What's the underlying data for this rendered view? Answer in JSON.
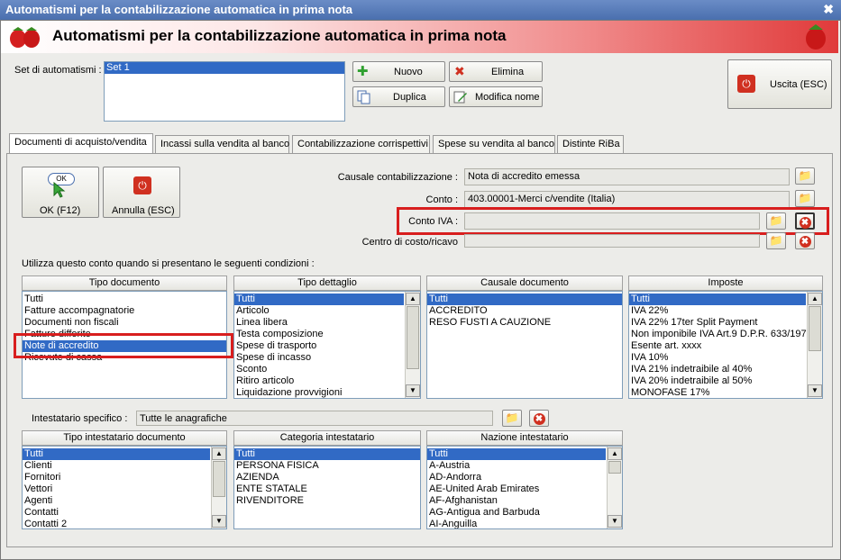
{
  "window": {
    "title": "Automatismi per la contabilizzazione automatica in prima nota",
    "close_glyph": "×"
  },
  "banner": {
    "title": "Automatismi per la contabilizzazione automatica in prima nota"
  },
  "set": {
    "label": "Set di automatismi :",
    "items": [
      "Set 1"
    ]
  },
  "toolbar": {
    "nuovo": "Nuovo",
    "elimina": "Elimina",
    "duplica": "Duplica",
    "modifica": "Modifica nome",
    "uscita": "Uscita (ESC)"
  },
  "tabs": [
    "Documenti di acquisto/vendita",
    "Incassi sulla vendita al banco",
    "Contabilizzazione corrispettivi",
    "Spese su vendita al banco",
    "Distinte RiBa"
  ],
  "actions": {
    "ok": "OK (F12)",
    "ok_icon_text": "OK",
    "annulla": "Annulla (ESC)"
  },
  "form": {
    "causale_label": "Causale contabilizzazione :",
    "causale_value": "Nota di accredito emessa",
    "conto_label": "Conto :",
    "conto_value": "403.00001-Merci c/vendite (Italia)",
    "conto_iva_label": "Conto IVA :",
    "conto_iva_value": "",
    "centro_label": "Centro di costo/ricavo",
    "centro_value": ""
  },
  "conditions_label": "Utilizza questo conto quando si presentano le seguenti condizioni :",
  "lists": {
    "tipo_documento": {
      "header": "Tipo documento",
      "items": [
        "Tutti",
        "Fatture accompagnatorie",
        "Documenti non fiscali",
        "Fatture differite",
        "Note di accredito",
        "Ricevute di cassa"
      ]
    },
    "tipo_dettaglio": {
      "header": "Tipo dettaglio",
      "items": [
        "Tutti",
        "Articolo",
        "Linea libera",
        "Testa composizione",
        "Spese di trasporto",
        "Spese di incasso",
        "Sconto",
        "Ritiro articolo",
        "Liquidazione provvigioni"
      ]
    },
    "causale_documento": {
      "header": "Causale documento",
      "items": [
        "Tutti",
        "ACCREDITO",
        "RESO FUSTI A CAUZIONE"
      ]
    },
    "imposte": {
      "header": "Imposte",
      "items": [
        "Tutti",
        "IVA 22%",
        "IVA 22% 17ter Split Payment",
        "Non imponibile IVA Art.9 D.P.R. 633/197",
        "Esente art. xxxx",
        "IVA 10%",
        "IVA 21% indetraibile al 40%",
        "IVA 20% indetraibile al 50%",
        "MONOFASE 17%"
      ]
    },
    "tipo_intestatario": {
      "header": "Tipo intestatario documento",
      "items": [
        "Tutti",
        "Clienti",
        "Fornitori",
        "Vettori",
        "Agenti",
        "Contatti",
        "Contatti 2"
      ]
    },
    "categoria": {
      "header": "Categoria intestatario",
      "items": [
        "Tutti",
        "PERSONA FISICA",
        "AZIENDA",
        "ENTE STATALE",
        "RIVENDITORE"
      ]
    },
    "nazione": {
      "header": "Nazione intestatario",
      "items": [
        "Tutti",
        "A-Austria",
        "AD-Andorra",
        "AE-United Arab Emirates",
        "AF-Afghanistan",
        "AG-Antigua and Barbuda",
        "AI-Anguilla"
      ]
    }
  },
  "intestatario": {
    "label": "Intestatario specifico :",
    "value": "Tutte le anagrafiche"
  },
  "glyphs": {
    "plus": "✚",
    "x": "✖",
    "folder": "📁",
    "arrow_up": "▲",
    "arrow_down": "▼",
    "stop": "⏻"
  },
  "colors": {
    "selection": "#316ac5",
    "highlight_box": "#d81e1e",
    "banner_red": "#e03a3a"
  }
}
